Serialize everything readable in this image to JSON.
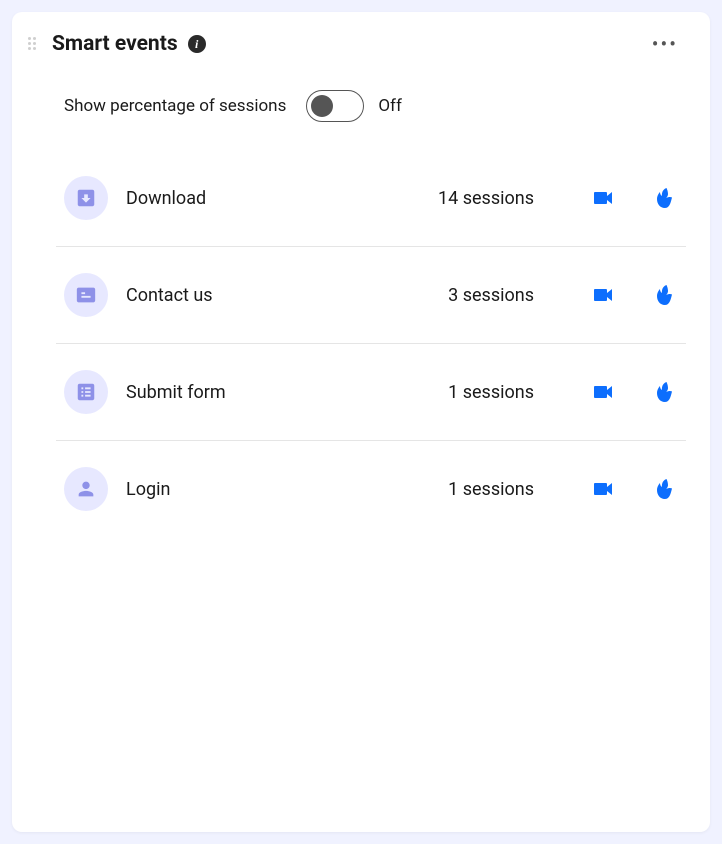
{
  "header": {
    "title": "Smart events"
  },
  "toggle": {
    "label": "Show percentage of sessions",
    "state": "Off"
  },
  "events": [
    {
      "icon": "download-icon",
      "name": "Download",
      "sessions": "14 sessions"
    },
    {
      "icon": "contact-icon",
      "name": "Contact us",
      "sessions": "3 sessions"
    },
    {
      "icon": "form-icon",
      "name": "Submit form",
      "sessions": "1 sessions"
    },
    {
      "icon": "login-icon",
      "name": "Login",
      "sessions": "1 sessions"
    }
  ]
}
